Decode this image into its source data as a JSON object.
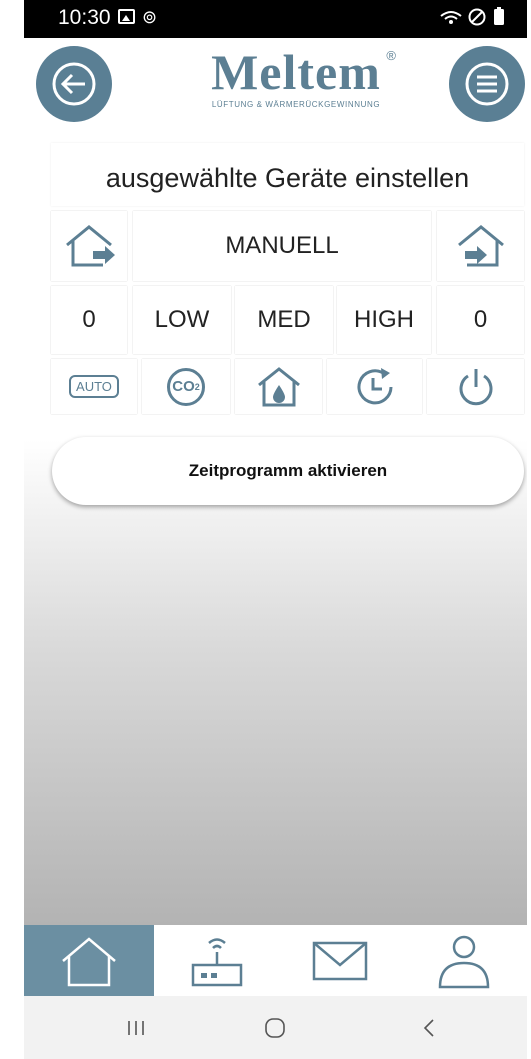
{
  "status": {
    "time": "10:30",
    "right_icons": "wifi-dnd-battery"
  },
  "header": {
    "logo_word": "Meltem",
    "logo_reg": "®",
    "logo_sub": "LÜFTUNG & WÄRMERÜCKGEWINNUNG",
    "icons": {
      "back": "arrow-left-icon",
      "menu": "hamburger-icon"
    }
  },
  "panel": {
    "title": "ausgewählte Geräte einstellen",
    "mode_label": "MANUELL",
    "exhaust_value": "0",
    "supply_value": "0",
    "levels": [
      "LOW",
      "MED",
      "HIGH"
    ],
    "mode_buttons": [
      {
        "name": "auto",
        "label": "AUTO"
      },
      {
        "name": "co2",
        "label": "CO",
        "sub": "2"
      },
      {
        "name": "humidity",
        "label": ""
      },
      {
        "name": "timer",
        "label": ""
      },
      {
        "name": "power",
        "label": ""
      }
    ]
  },
  "cta": {
    "label": "Zeitprogramm aktivieren"
  },
  "tabs": [
    {
      "name": "home",
      "icon": "home-icon",
      "active": true
    },
    {
      "name": "devices",
      "icon": "router-icon",
      "active": false
    },
    {
      "name": "messages",
      "icon": "mail-icon",
      "active": false
    },
    {
      "name": "profile",
      "icon": "user-icon",
      "active": false
    }
  ],
  "colors": {
    "accent": "#5a7f94",
    "tab_active": "#6b8fa2",
    "icon": "#5c7f93"
  }
}
